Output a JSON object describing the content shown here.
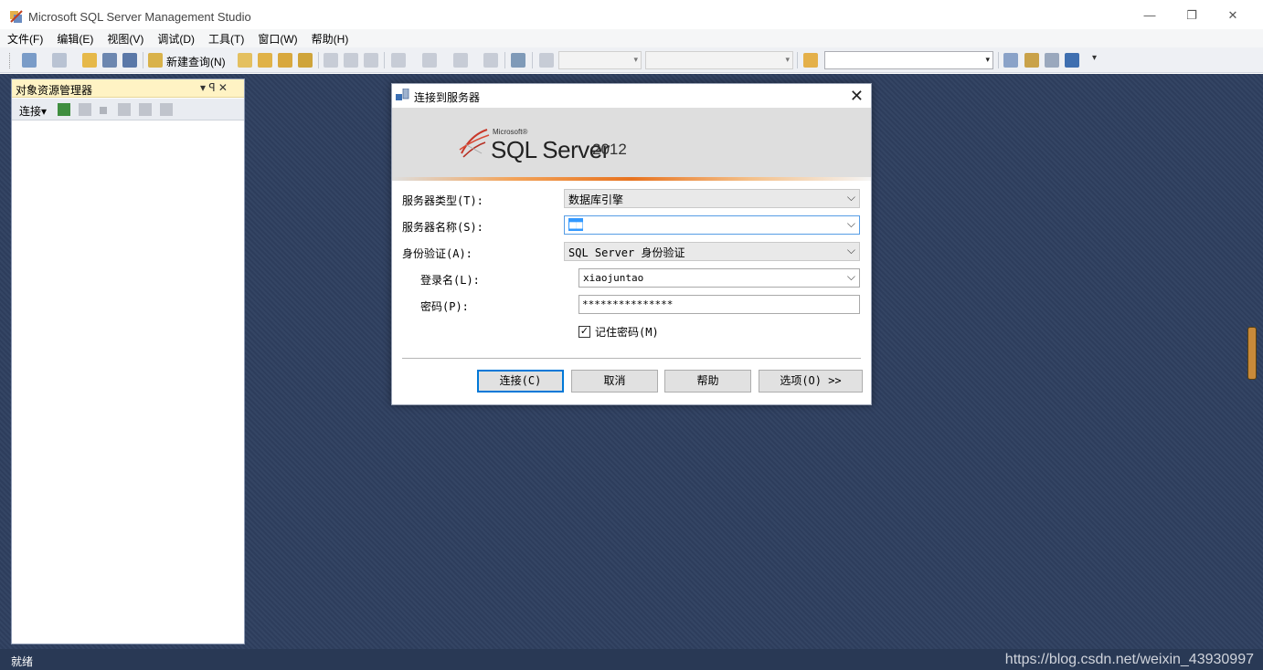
{
  "window": {
    "title": "Microsoft SQL Server Management Studio",
    "min_glyph": "—",
    "restore_glyph": "❐",
    "close_glyph": "✕"
  },
  "menu": [
    "文件(F)",
    "编辑(E)",
    "视图(V)",
    "调试(D)",
    "工具(T)",
    "窗口(W)",
    "帮助(H)"
  ],
  "toolbar": {
    "new_query_label": "新建查询(N)"
  },
  "object_explorer": {
    "title": "对象资源管理器",
    "pin_glyph": "▾ ꟼ ✕",
    "connect_label": "连接▾"
  },
  "dialog": {
    "title": "连接到服务器",
    "close_glyph": "✕",
    "logo": {
      "microsoft": "Microsoft®",
      "product": "SQL Server",
      "year": "2012"
    },
    "fields": {
      "server_type_label": "服务器类型(T):",
      "server_type_value": "数据库引擎",
      "server_name_label": "服务器名称(S):",
      "server_name_value": "■■",
      "auth_label": "身份验证(A):",
      "auth_value": "SQL Server 身份验证",
      "login_label": "登录名(L):",
      "login_value": "xiaojuntao",
      "password_label": "密码(P):",
      "password_value": "***************",
      "remember_label": "记住密码(M)",
      "remember_checked": "☑"
    },
    "buttons": {
      "connect": "连接(C)",
      "cancel": "取消",
      "help": "帮助",
      "options": "选项(O) >>"
    }
  },
  "status": {
    "text": "就绪",
    "watermark": "https://blog.csdn.net/weixin_43930997"
  },
  "colors": {
    "workspace": "#2e3f5f",
    "status_bar": "#293955",
    "oe_header": "#fff3c4",
    "accent_orange": "#e8731f",
    "focus_blue": "#0078d7"
  }
}
